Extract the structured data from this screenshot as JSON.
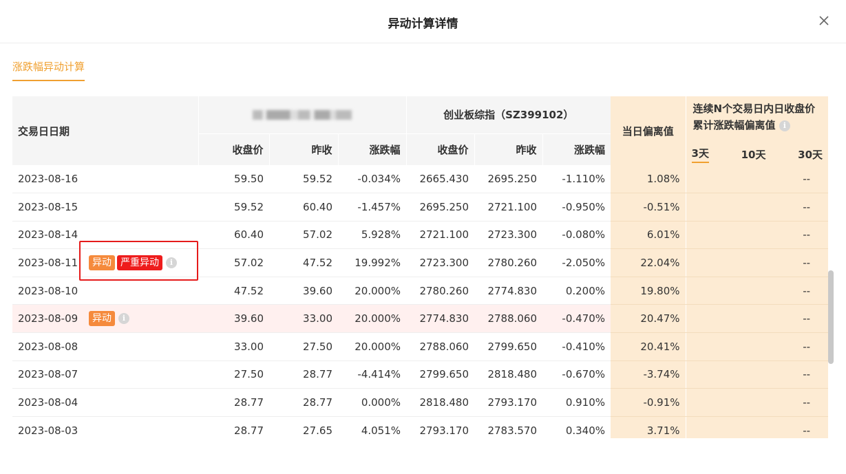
{
  "header": {
    "title": "异动计算详情"
  },
  "tabs": [
    {
      "label": "涨跌幅异动计算"
    }
  ],
  "table": {
    "date_header": "交易日日期",
    "stock_group": "",
    "index_group": "创业板综指（SZ399102）",
    "col_close": "收盘价",
    "col_prev": "昨收",
    "col_change": "涨跌幅",
    "deviation_header": "当日偏离值",
    "cumulative_header_line1": "连续N个交易日内日收盘价",
    "cumulative_header_line2": "累计涨跌幅偏离值",
    "cumulative_tabs": [
      "3天",
      "10天",
      "30天"
    ],
    "cumulative_active": "3天",
    "rows": [
      {
        "date": "2023-08-16",
        "badges": [],
        "s_close": "59.50",
        "s_prev": "59.52",
        "s_chg": "-0.034%",
        "i_close": "2665.430",
        "i_prev": "2695.250",
        "i_chg": "-1.110%",
        "dev": "1.08%",
        "cum": "--"
      },
      {
        "date": "2023-08-15",
        "badges": [],
        "s_close": "59.52",
        "s_prev": "60.40",
        "s_chg": "-1.457%",
        "i_close": "2695.250",
        "i_prev": "2721.100",
        "i_chg": "-0.950%",
        "dev": "-0.51%",
        "cum": "--"
      },
      {
        "date": "2023-08-14",
        "badges": [],
        "s_close": "60.40",
        "s_prev": "57.02",
        "s_chg": "5.928%",
        "i_close": "2721.100",
        "i_prev": "2723.300",
        "i_chg": "-0.080%",
        "dev": "6.01%",
        "cum": "--"
      },
      {
        "date": "2023-08-11",
        "badges": [
          "异动",
          "严重异动"
        ],
        "s_close": "57.02",
        "s_prev": "47.52",
        "s_chg": "19.992%",
        "i_close": "2723.300",
        "i_prev": "2780.260",
        "i_chg": "-2.050%",
        "dev": "22.04%",
        "cum": "--"
      },
      {
        "date": "2023-08-10",
        "badges": [],
        "s_close": "47.52",
        "s_prev": "39.60",
        "s_chg": "20.000%",
        "i_close": "2780.260",
        "i_prev": "2774.830",
        "i_chg": "0.200%",
        "dev": "19.80%",
        "cum": "--"
      },
      {
        "date": "2023-08-09",
        "badges": [
          "异动"
        ],
        "highlight": true,
        "s_close": "39.60",
        "s_prev": "33.00",
        "s_chg": "20.000%",
        "i_close": "2774.830",
        "i_prev": "2788.060",
        "i_chg": "-0.470%",
        "dev": "20.47%",
        "cum": "--"
      },
      {
        "date": "2023-08-08",
        "badges": [],
        "s_close": "33.00",
        "s_prev": "27.50",
        "s_chg": "20.000%",
        "i_close": "2788.060",
        "i_prev": "2799.650",
        "i_chg": "-0.410%",
        "dev": "20.41%",
        "cum": "--"
      },
      {
        "date": "2023-08-07",
        "badges": [],
        "s_close": "27.50",
        "s_prev": "28.77",
        "s_chg": "-4.414%",
        "i_close": "2799.650",
        "i_prev": "2818.480",
        "i_chg": "-0.670%",
        "dev": "-3.74%",
        "cum": "--"
      },
      {
        "date": "2023-08-04",
        "badges": [],
        "s_close": "28.77",
        "s_prev": "28.77",
        "s_chg": "0.000%",
        "i_close": "2818.480",
        "i_prev": "2793.170",
        "i_chg": "0.910%",
        "dev": "-0.91%",
        "cum": "--"
      },
      {
        "date": "2023-08-03",
        "badges": [],
        "s_close": "28.77",
        "s_prev": "27.65",
        "s_chg": "4.051%",
        "i_close": "2793.170",
        "i_prev": "2783.570",
        "i_chg": "0.340%",
        "dev": "3.71%",
        "cum": "--"
      }
    ]
  },
  "colors": {
    "accent": "#f0a030",
    "badge_orange": "#f58a3c",
    "badge_red": "#ee1c1c",
    "deviation_bg": "#fdebd3"
  },
  "icons": {
    "close": "close-icon",
    "info": "info-icon"
  }
}
